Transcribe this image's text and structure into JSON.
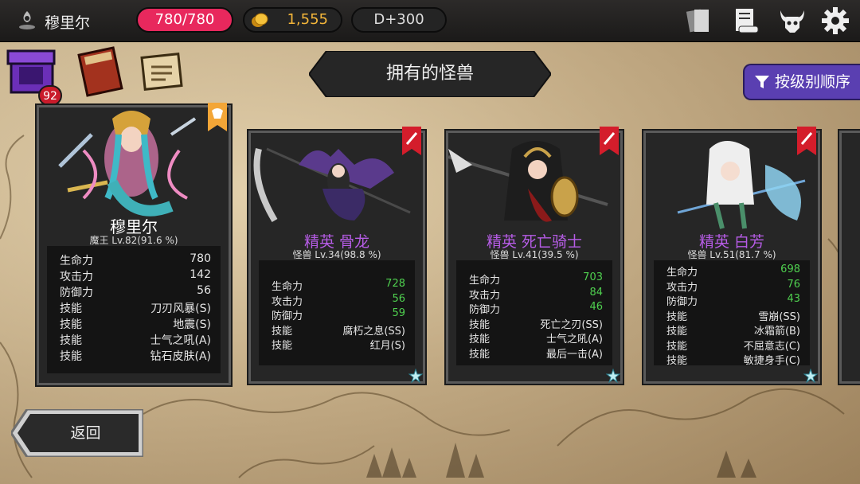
{
  "header": {
    "player_name": "穆里尔",
    "hp": "780/780",
    "gold": "1,555",
    "day": "D+300"
  },
  "inventory": {
    "count": "92"
  },
  "title": "拥有的怪兽",
  "sort_label": "按级别顺序",
  "back_label": "返回",
  "colors": {
    "elite_name": "#b65ce6",
    "boss_name": "#ffffff",
    "stat_value_green": "#4fd04f",
    "hp_pill": "#e8285d",
    "sort_button": "#5a3fb1"
  },
  "cards": [
    {
      "name": "穆里尔",
      "subtitle": "魔王 Lv.82(91.6 %)",
      "stats": [
        {
          "label": "生命力",
          "value": "780"
        },
        {
          "label": "攻击力",
          "value": "142"
        },
        {
          "label": "防御力",
          "value": "56"
        },
        {
          "label": "技能",
          "value": "刀刃风暴(S)"
        },
        {
          "label": "技能",
          "value": "地震(S)"
        },
        {
          "label": "技能",
          "value": "士气之吼(A)"
        },
        {
          "label": "技能",
          "value": "钻石皮肤(A)"
        }
      ]
    },
    {
      "name": "精英 骨龙",
      "subtitle": "怪兽 Lv.34(98.8 %)",
      "stats": [
        {
          "label": "生命力",
          "value": "728"
        },
        {
          "label": "攻击力",
          "value": "56"
        },
        {
          "label": "防御力",
          "value": "59"
        },
        {
          "label": "技能",
          "value": "腐朽之息(SS)"
        },
        {
          "label": "技能",
          "value": "红月(S)"
        }
      ]
    },
    {
      "name": "精英 死亡骑士",
      "subtitle": "怪兽 Lv.41(39.5 %)",
      "stats": [
        {
          "label": "生命力",
          "value": "703"
        },
        {
          "label": "攻击力",
          "value": "84"
        },
        {
          "label": "防御力",
          "value": "46"
        },
        {
          "label": "技能",
          "value": "死亡之刃(SS)"
        },
        {
          "label": "技能",
          "value": "士气之吼(A)"
        },
        {
          "label": "技能",
          "value": "最后一击(A)"
        }
      ]
    },
    {
      "name": "精英 白芳",
      "subtitle": "怪兽 Lv.51(81.7 %)",
      "stats": [
        {
          "label": "生命力",
          "value": "698"
        },
        {
          "label": "攻击力",
          "value": "76"
        },
        {
          "label": "防御力",
          "value": "43"
        },
        {
          "label": "技能",
          "value": "雪崩(SS)"
        },
        {
          "label": "技能",
          "value": "冰霜箭(B)"
        },
        {
          "label": "技能",
          "value": "不屈意志(C)"
        },
        {
          "label": "技能",
          "value": "敏捷身手(C)"
        }
      ]
    }
  ]
}
